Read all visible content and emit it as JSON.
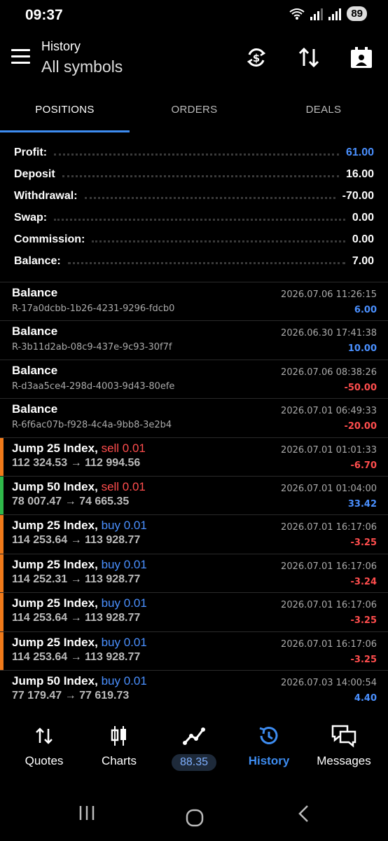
{
  "status_bar": {
    "time": "09:37",
    "battery": "89"
  },
  "header": {
    "title": "History",
    "subtitle": "All symbols"
  },
  "tabs": [
    {
      "label": "POSITIONS",
      "active": true
    },
    {
      "label": "ORDERS",
      "active": false
    },
    {
      "label": "DEALS",
      "active": false
    }
  ],
  "summary": [
    {
      "label": "Profit:",
      "value": "61.00",
      "highlight": true
    },
    {
      "label": "Deposit",
      "value": "16.00"
    },
    {
      "label": "Withdrawal:",
      "value": "-70.00"
    },
    {
      "label": "Swap:",
      "value": "0.00"
    },
    {
      "label": "Commission:",
      "value": "0.00"
    },
    {
      "label": "Balance:",
      "value": "7.00"
    }
  ],
  "items": [
    {
      "kind": "balance",
      "title": "Balance",
      "sub": "R-17a0dcbb-1b26-4231-9296-fdcb0",
      "date": "2026.07.06 11:26:15",
      "amount": "6.00",
      "sign": "pos"
    },
    {
      "kind": "balance",
      "title": "Balance",
      "sub": "R-3b11d2ab-08c9-437e-9c93-30f7f",
      "date": "2026.06.30 17:41:38",
      "amount": "10.00",
      "sign": "pos"
    },
    {
      "kind": "balance",
      "title": "Balance",
      "sub": "R-d3aa5ce4-298d-4003-9d43-80efe",
      "date": "2026.07.06 08:38:26",
      "amount": "-50.00",
      "sign": "neg"
    },
    {
      "kind": "balance",
      "title": "Balance",
      "sub": "R-6f6ac07b-f928-4c4a-9bb8-3e2b4",
      "date": "2026.07.01 06:49:33",
      "amount": "-20.00",
      "sign": "neg"
    },
    {
      "kind": "trade",
      "symbol": "Jump 25 Index,",
      "direction": "sell 0.01",
      "dir": "sell",
      "prices": "112 324.53 → 112 994.56",
      "date": "2026.07.01 01:01:33",
      "amount": "-6.70",
      "sign": "neg",
      "bar": "#f07a1a"
    },
    {
      "kind": "trade",
      "symbol": "Jump 50 Index,",
      "direction": "sell 0.01",
      "dir": "sell",
      "prices": "78 007.47 → 74 665.35",
      "date": "2026.07.01 01:04:00",
      "amount": "33.42",
      "sign": "pos",
      "bar": "#2fb84a"
    },
    {
      "kind": "trade",
      "symbol": "Jump 25 Index,",
      "direction": "buy 0.01",
      "dir": "buy",
      "prices": "114 253.64 → 113 928.77",
      "date": "2026.07.01 16:17:06",
      "amount": "-3.25",
      "sign": "neg",
      "bar": "#f07a1a"
    },
    {
      "kind": "trade",
      "symbol": "Jump 25 Index,",
      "direction": "buy 0.01",
      "dir": "buy",
      "prices": "114 252.31 → 113 928.77",
      "date": "2026.07.01 16:17:06",
      "amount": "-3.24",
      "sign": "neg",
      "bar": "#f07a1a"
    },
    {
      "kind": "trade",
      "symbol": "Jump 25 Index,",
      "direction": "buy 0.01",
      "dir": "buy",
      "prices": "114 253.64 → 113 928.77",
      "date": "2026.07.01 16:17:06",
      "amount": "-3.25",
      "sign": "neg",
      "bar": "#f07a1a"
    },
    {
      "kind": "trade",
      "symbol": "Jump 25 Index,",
      "direction": "buy 0.01",
      "dir": "buy",
      "prices": "114 253.64 → 113 928.77",
      "date": "2026.07.01 16:17:06",
      "amount": "-3.25",
      "sign": "neg",
      "bar": "#f07a1a"
    },
    {
      "kind": "trade",
      "symbol": "Jump 50 Index,",
      "direction": "buy 0.01",
      "dir": "buy",
      "prices": "77 179.47 → 77 619.73",
      "date": "2026.07.03 14:00:54",
      "amount": "4.40",
      "sign": "pos",
      "bar": ""
    }
  ],
  "bottom_nav": {
    "quotes": "Quotes",
    "charts": "Charts",
    "trade_value": "88.35",
    "history": "History",
    "messages": "Messages"
  },
  "colors": {
    "accent": "#3d8cf0",
    "profit": "#4a90ff",
    "loss": "#ff4d4d",
    "orange_bar": "#f07a1a",
    "green_bar": "#2fb84a"
  }
}
